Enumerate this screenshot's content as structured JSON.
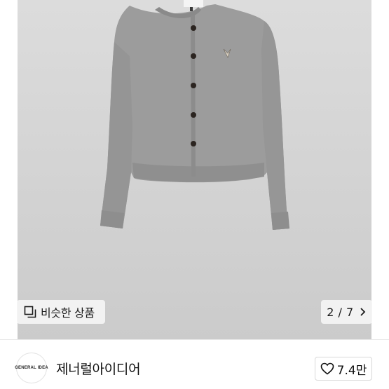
{
  "gallery": {
    "similar_label": "비슷한 상품",
    "counter": "2 / 7",
    "product_tag": "GENERAL IDEA"
  },
  "shop": {
    "name": "제너럴아이디어",
    "logo_text": "GENERAL IDEA",
    "like_count": "7.4만"
  },
  "colors": {
    "cardigan": "#9a9a9a",
    "buttons": "#2b2420",
    "background": "#d4d4d4"
  }
}
